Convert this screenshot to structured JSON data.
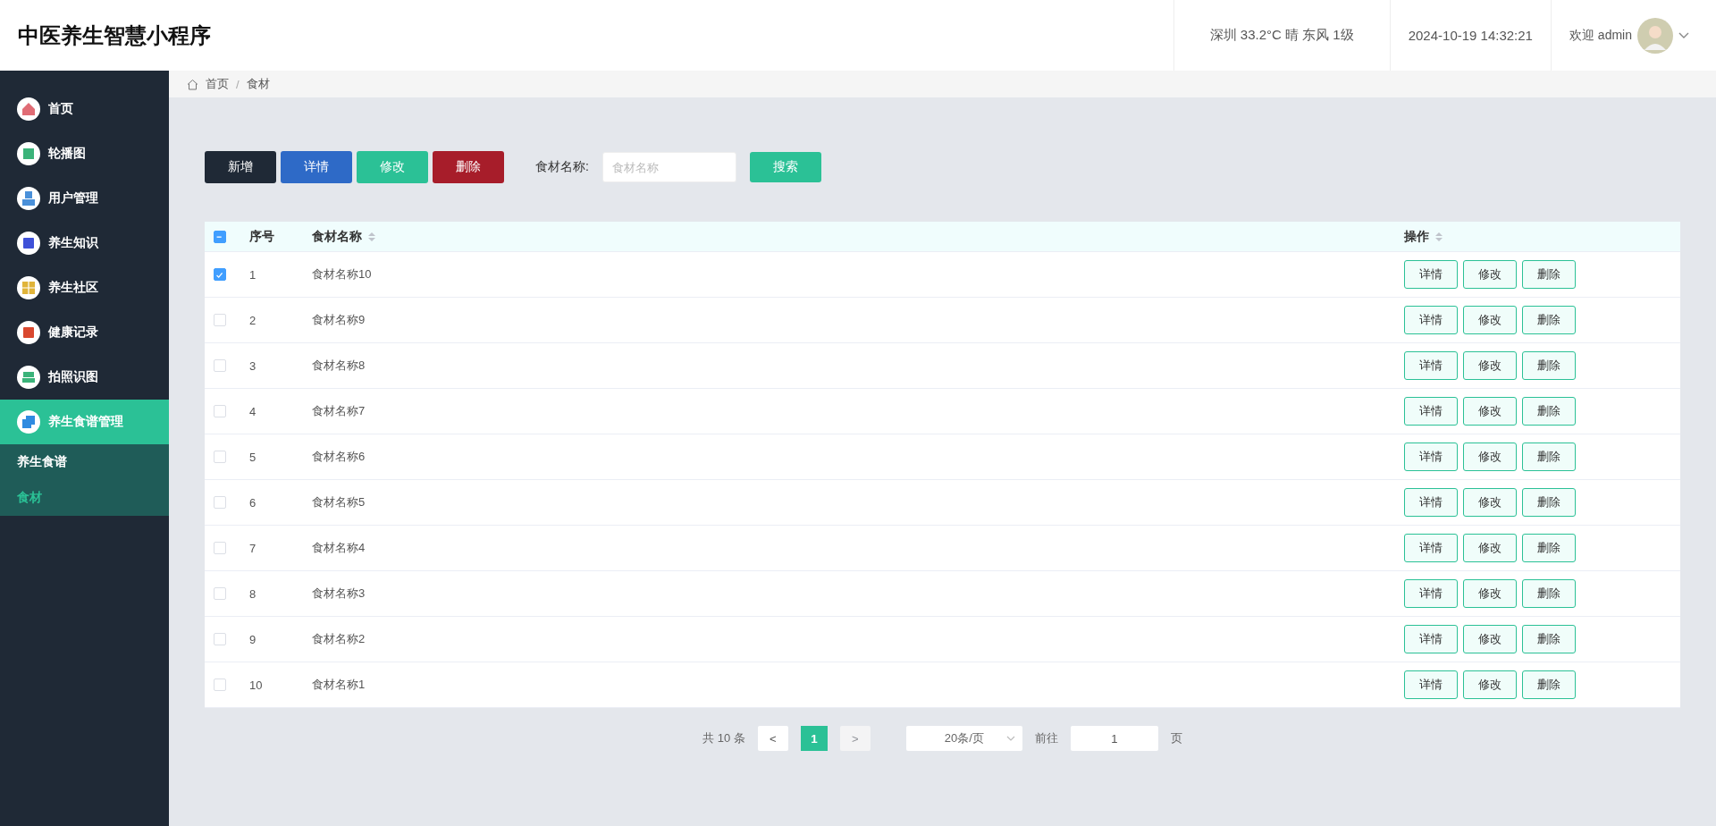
{
  "header": {
    "title": "中医养生智慧小程序",
    "weather": "深圳 33.2°C 晴 东风 1级",
    "datetime": "2024-10-19 14:32:21",
    "welcome": "欢迎 admin"
  },
  "sidebar": {
    "items": [
      {
        "label": "首页",
        "color": "#e06c75",
        "selected": false
      },
      {
        "label": "轮播图",
        "color": "#3bb37a",
        "selected": false
      },
      {
        "label": "用户管理",
        "color": "#4a90d9",
        "selected": false
      },
      {
        "label": "养生知识",
        "color": "#3f51d8",
        "selected": false
      },
      {
        "label": "养生社区",
        "color": "#e0b43a",
        "selected": false
      },
      {
        "label": "健康记录",
        "color": "#d9482f",
        "selected": false
      },
      {
        "label": "拍照识图",
        "color": "#3bb37a",
        "selected": false
      },
      {
        "label": "养生食谱管理",
        "color": "#2f8be0",
        "selected": true,
        "children": [
          {
            "label": "养生食谱",
            "selected": false
          },
          {
            "label": "食材",
            "selected": true
          }
        ]
      }
    ]
  },
  "breadcrumb": {
    "items": [
      "首页",
      "食材"
    ],
    "separator": "/"
  },
  "toolbar": {
    "buttons": [
      {
        "label": "新增",
        "kind": "add"
      },
      {
        "label": "详情",
        "kind": "detail"
      },
      {
        "label": "修改",
        "kind": "edit"
      },
      {
        "label": "删除",
        "kind": "delete"
      }
    ],
    "search_label": "食材名称:",
    "search_placeholder": "食材名称",
    "search_button": "搜索"
  },
  "table": {
    "header_checkbox_indeterminate": true,
    "columns": [
      "序号",
      "食材名称",
      "操作"
    ],
    "rows": [
      {
        "index": "1",
        "name": "食材名称10",
        "checked": true,
        "actions": [
          "详情",
          "修改",
          "删除"
        ]
      },
      {
        "index": "2",
        "name": "食材名称9",
        "checked": false,
        "actions": [
          "详情",
          "修改",
          "删除"
        ]
      },
      {
        "index": "3",
        "name": "食材名称8",
        "checked": false,
        "actions": [
          "详情",
          "修改",
          "删除"
        ]
      },
      {
        "index": "4",
        "name": "食材名称7",
        "checked": false,
        "actions": [
          "详情",
          "修改",
          "删除"
        ]
      },
      {
        "index": "5",
        "name": "食材名称6",
        "checked": false,
        "actions": [
          "详情",
          "修改",
          "删除"
        ]
      },
      {
        "index": "6",
        "name": "食材名称5",
        "checked": false,
        "actions": [
          "详情",
          "修改",
          "删除"
        ]
      },
      {
        "index": "7",
        "name": "食材名称4",
        "checked": false,
        "actions": [
          "详情",
          "修改",
          "删除"
        ]
      },
      {
        "index": "8",
        "name": "食材名称3",
        "checked": false,
        "actions": [
          "详情",
          "修改",
          "删除"
        ]
      },
      {
        "index": "9",
        "name": "食材名称2",
        "checked": false,
        "actions": [
          "详情",
          "修改",
          "删除"
        ]
      },
      {
        "index": "10",
        "name": "食材名称1",
        "checked": false,
        "actions": [
          "详情",
          "修改",
          "删除"
        ]
      }
    ]
  },
  "pagination": {
    "total": "共 10 条",
    "prev": {
      "label": "<",
      "disabled": false
    },
    "pages": [
      {
        "label": "1",
        "selected": true
      }
    ],
    "next": {
      "label": ">",
      "disabled": true
    },
    "page_size": "20条/页",
    "goto_label": "前往",
    "goto_value": "1",
    "goto_suffix": "页"
  }
}
